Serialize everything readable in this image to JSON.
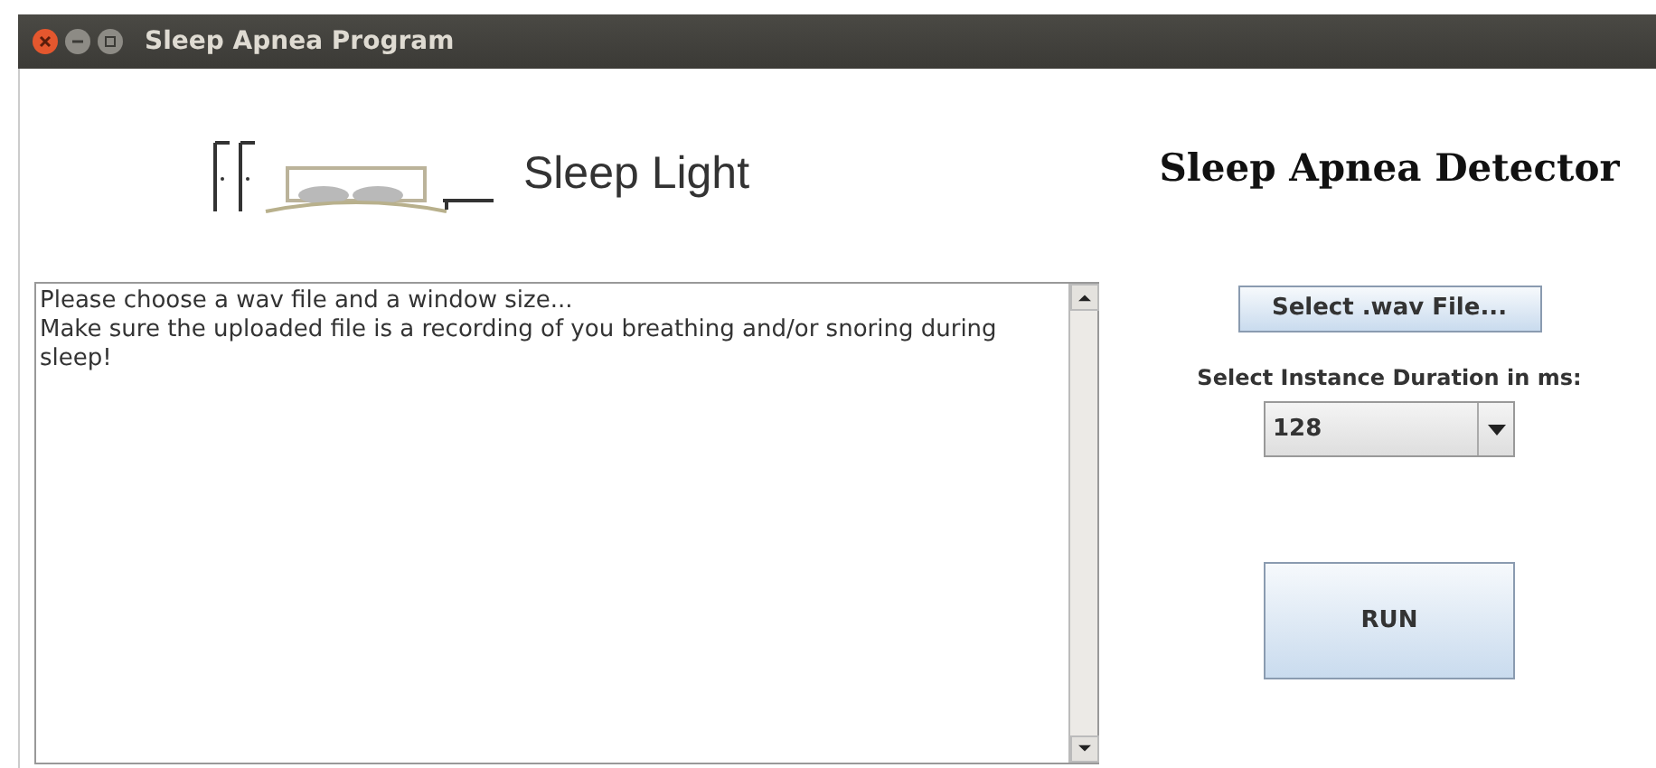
{
  "window": {
    "title": "Sleep Apnea Program"
  },
  "logo": {
    "text": "Sleep Light"
  },
  "heading": "Sleep Apnea Detector",
  "output": {
    "lines": [
      "Please choose a wav file and a window size...",
      "Make sure the uploaded file is a recording of you breathing and/or snoring during sleep!"
    ]
  },
  "select_file_button": "Select .wav File...",
  "duration": {
    "label": "Select Instance Duration in ms:",
    "value": "128"
  },
  "run_button": "RUN"
}
